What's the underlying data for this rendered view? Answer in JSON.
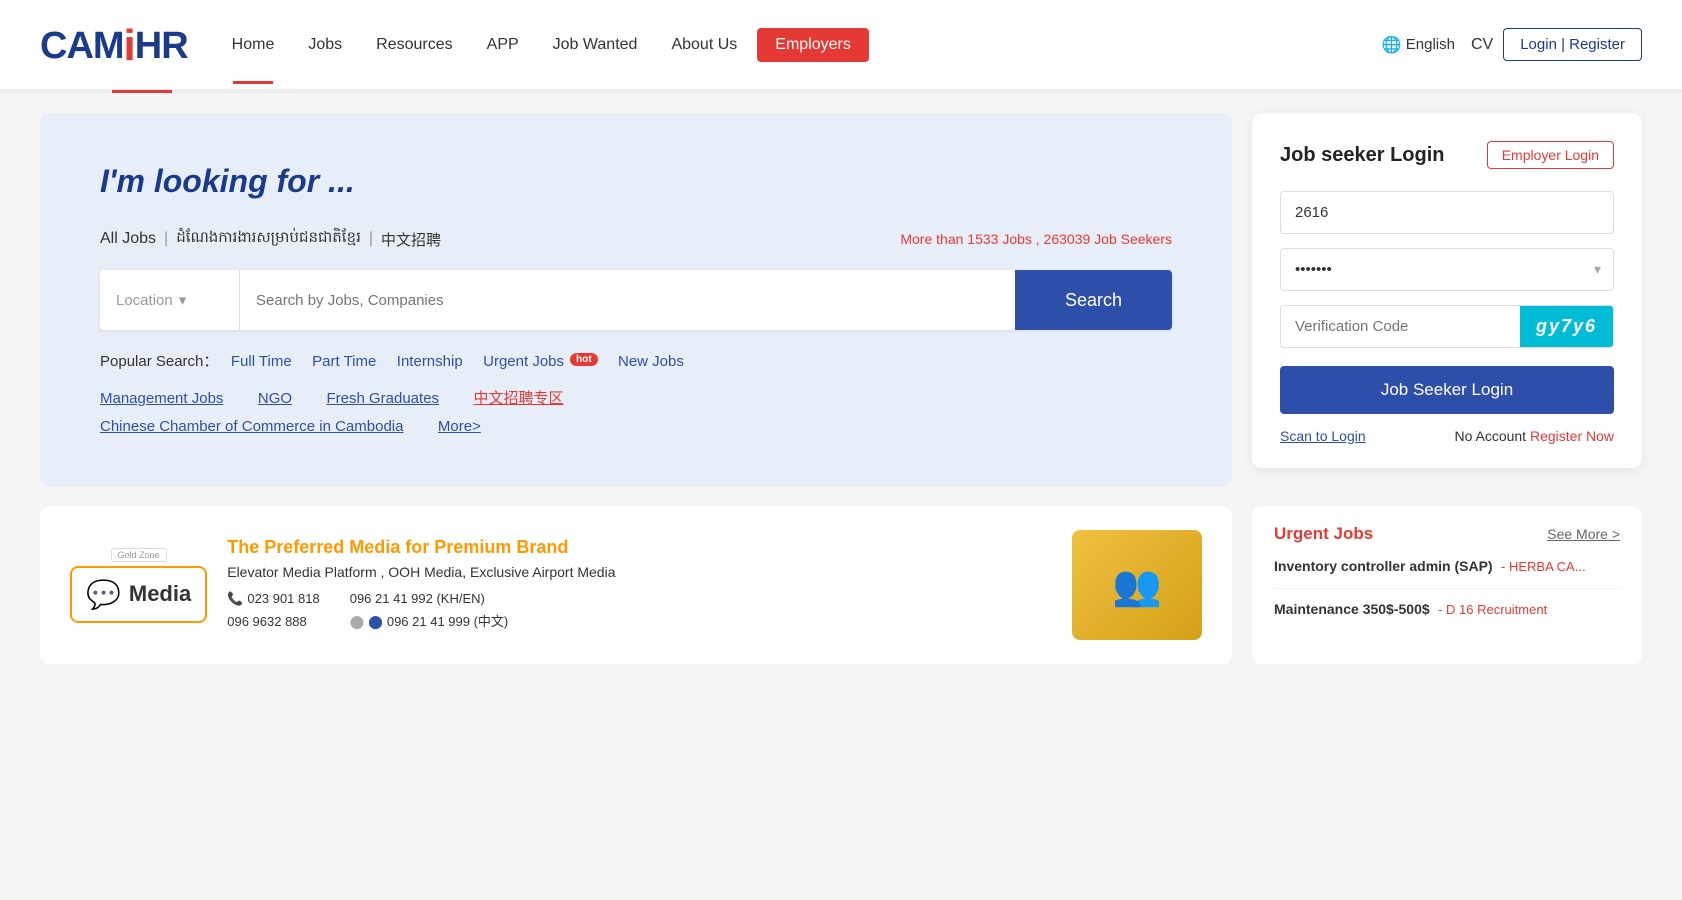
{
  "header": {
    "logo": "CAMHR",
    "nav": [
      {
        "label": "Home",
        "id": "home",
        "active": true
      },
      {
        "label": "Jobs",
        "id": "jobs",
        "active": false
      },
      {
        "label": "Resources",
        "id": "resources",
        "active": false
      },
      {
        "label": "APP",
        "id": "app",
        "active": false
      },
      {
        "label": "Job Wanted",
        "id": "job-wanted",
        "active": false
      },
      {
        "label": "About Us",
        "id": "about-us",
        "active": false
      },
      {
        "label": "Employers",
        "id": "employers",
        "active": false,
        "highlighted": true
      }
    ],
    "language": "English",
    "cv_label": "CV",
    "login_register": "Login | Register"
  },
  "hero": {
    "title": "I'm looking for ...",
    "all_jobs": "All Jobs",
    "khmer_text": "ដំណែងការងារសម្រាប់ជនជាតិខ្មែរ",
    "chinese_text": "中文招聘",
    "job_count": "More than 1533 Jobs , 263039 Job Seekers",
    "location_placeholder": "Location",
    "search_placeholder": "Search by Jobs, Companies",
    "search_btn": "Search",
    "popular_label": "Popular Search：",
    "tags": [
      {
        "label": "Full Time",
        "hot": false
      },
      {
        "label": "Part Time",
        "hot": false
      },
      {
        "label": "Internship",
        "hot": false
      },
      {
        "label": "Urgent Jobs",
        "hot": true
      },
      {
        "label": "New Jobs",
        "hot": false
      }
    ],
    "more_links": [
      {
        "label": "Management Jobs",
        "chinese": false
      },
      {
        "label": "NGO",
        "chinese": false
      },
      {
        "label": "Fresh Graduates",
        "chinese": false
      },
      {
        "label": "中文招聘专区",
        "chinese": true
      },
      {
        "label": "Chinese Chamber of Commerce in Cambodia",
        "chinese": false
      },
      {
        "label": "More>",
        "chinese": false
      }
    ]
  },
  "login": {
    "title": "Job seeker Login",
    "employer_btn": "Employer Login",
    "username_value": "2616",
    "password_value": "•••••••",
    "captcha_placeholder": "Verification Code",
    "captcha_code": "gy7y6",
    "login_btn": "Job Seeker Login",
    "scan_login": "Scan to Login",
    "no_account": "No Account",
    "register_now": "Register Now"
  },
  "ad": {
    "gold_zone": "Gold Zone",
    "logo_text": "Media",
    "title": "The Preferred Media for Premium Brand",
    "subtitle": "Elevator Media Platform , OOH Media, Exclusive Airport Media",
    "phone1": "023 901 818",
    "phone2": "096 21 41 992 (KH/EN)",
    "phone3": "096 9632 888",
    "phone4": "096 21 41 999 (中文)"
  },
  "urgent_jobs": {
    "title": "Urgent Jobs",
    "see_more": "See More >",
    "jobs": [
      {
        "title": "Inventory controller admin (SAP)",
        "company": "- HERBA CA...",
        "salary": ""
      },
      {
        "title": "Maintenance 350$-500$",
        "company": "- D 16 Recruitment",
        "salary": ""
      }
    ]
  }
}
